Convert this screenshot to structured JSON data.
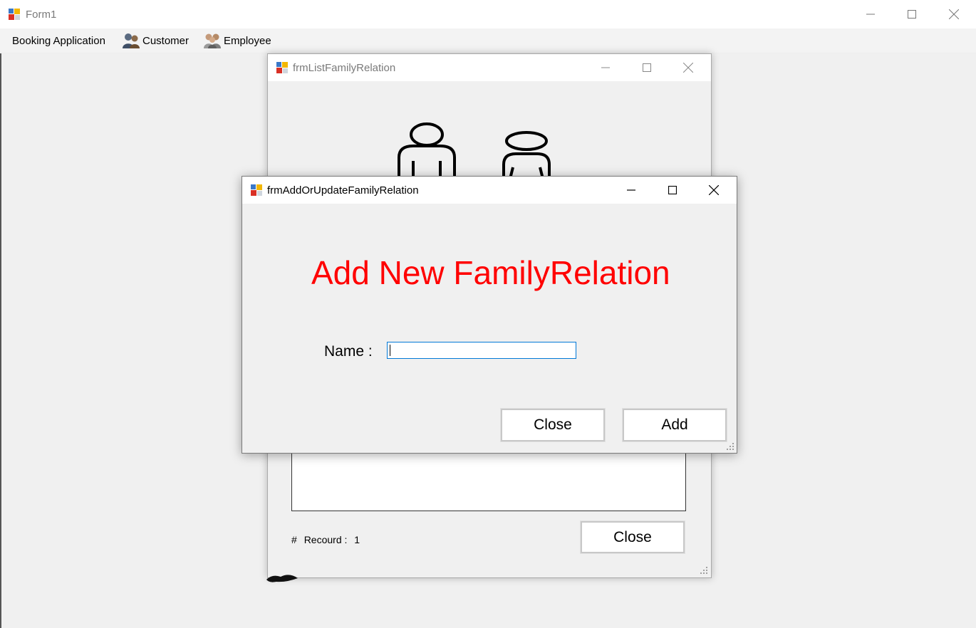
{
  "main_window": {
    "title": "Form1",
    "menu": [
      {
        "label": "Booking Application",
        "icon": ""
      },
      {
        "label": "Customer",
        "icon": "customer-icon"
      },
      {
        "label": "Employee",
        "icon": "employee-icon"
      }
    ]
  },
  "list_window": {
    "title": "frmListFamilyRelation",
    "record_hash": "#",
    "record_label": "Recourd :",
    "record_count": "1",
    "close_label": "Close"
  },
  "add_dialog": {
    "title": "frmAddOrUpdateFamilyRelation",
    "heading": "Add New FamilyRelation",
    "name_label": "Name :",
    "name_value": "",
    "close_label": "Close",
    "add_label": "Add",
    "heading_color": "#ff0000",
    "input_border_color": "#0078d7"
  }
}
